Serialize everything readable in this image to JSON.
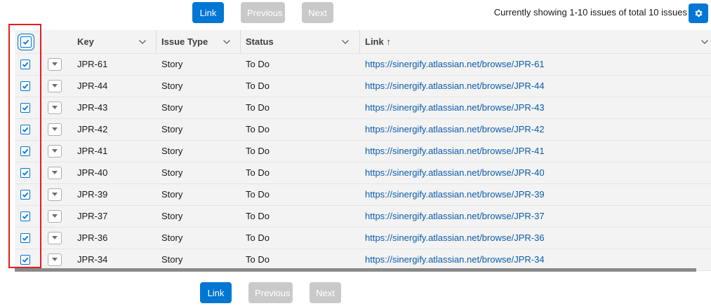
{
  "top_toolbar": {
    "link_label": "Link",
    "previous_label": "Previous",
    "next_label": "Next",
    "status_text": "Currently showing 1-10 issues of total 10 issues"
  },
  "bottom_toolbar": {
    "link_label": "Link",
    "previous_label": "Previous",
    "next_label": "Next"
  },
  "table": {
    "columns": {
      "key": "Key",
      "issue_type": "Issue Type",
      "status": "Status",
      "link": "Link ↑"
    },
    "select_all_checked": true,
    "rows": [
      {
        "key": "JPR-61",
        "type": "Story",
        "status": "To Do",
        "link": "https://sinergify.atlassian.net/browse/JPR-61",
        "checked": true
      },
      {
        "key": "JPR-44",
        "type": "Story",
        "status": "To Do",
        "link": "https://sinergify.atlassian.net/browse/JPR-44",
        "checked": true
      },
      {
        "key": "JPR-43",
        "type": "Story",
        "status": "To Do",
        "link": "https://sinergify.atlassian.net/browse/JPR-43",
        "checked": true
      },
      {
        "key": "JPR-42",
        "type": "Story",
        "status": "To Do",
        "link": "https://sinergify.atlassian.net/browse/JPR-42",
        "checked": true
      },
      {
        "key": "JPR-41",
        "type": "Story",
        "status": "To Do",
        "link": "https://sinergify.atlassian.net/browse/JPR-41",
        "checked": true
      },
      {
        "key": "JPR-40",
        "type": "Story",
        "status": "To Do",
        "link": "https://sinergify.atlassian.net/browse/JPR-40",
        "checked": true
      },
      {
        "key": "JPR-39",
        "type": "Story",
        "status": "To Do",
        "link": "https://sinergify.atlassian.net/browse/JPR-39",
        "checked": true
      },
      {
        "key": "JPR-37",
        "type": "Story",
        "status": "To Do",
        "link": "https://sinergify.atlassian.net/browse/JPR-37",
        "checked": true
      },
      {
        "key": "JPR-36",
        "type": "Story",
        "status": "To Do",
        "link": "https://sinergify.atlassian.net/browse/JPR-36",
        "checked": true
      },
      {
        "key": "JPR-34",
        "type": "Story",
        "status": "To Do",
        "link": "https://sinergify.atlassian.net/browse/JPR-34",
        "checked": true
      }
    ]
  },
  "colors": {
    "brand": "#0176d3",
    "link": "#0b5cab",
    "highlight": "#e02020",
    "disabled": "#c9c9c9"
  },
  "icons": {
    "settings": "gear-icon",
    "row_action": "chevron-down-icon",
    "column_menu": "chevron-down-icon",
    "checkbox": "check-icon"
  }
}
